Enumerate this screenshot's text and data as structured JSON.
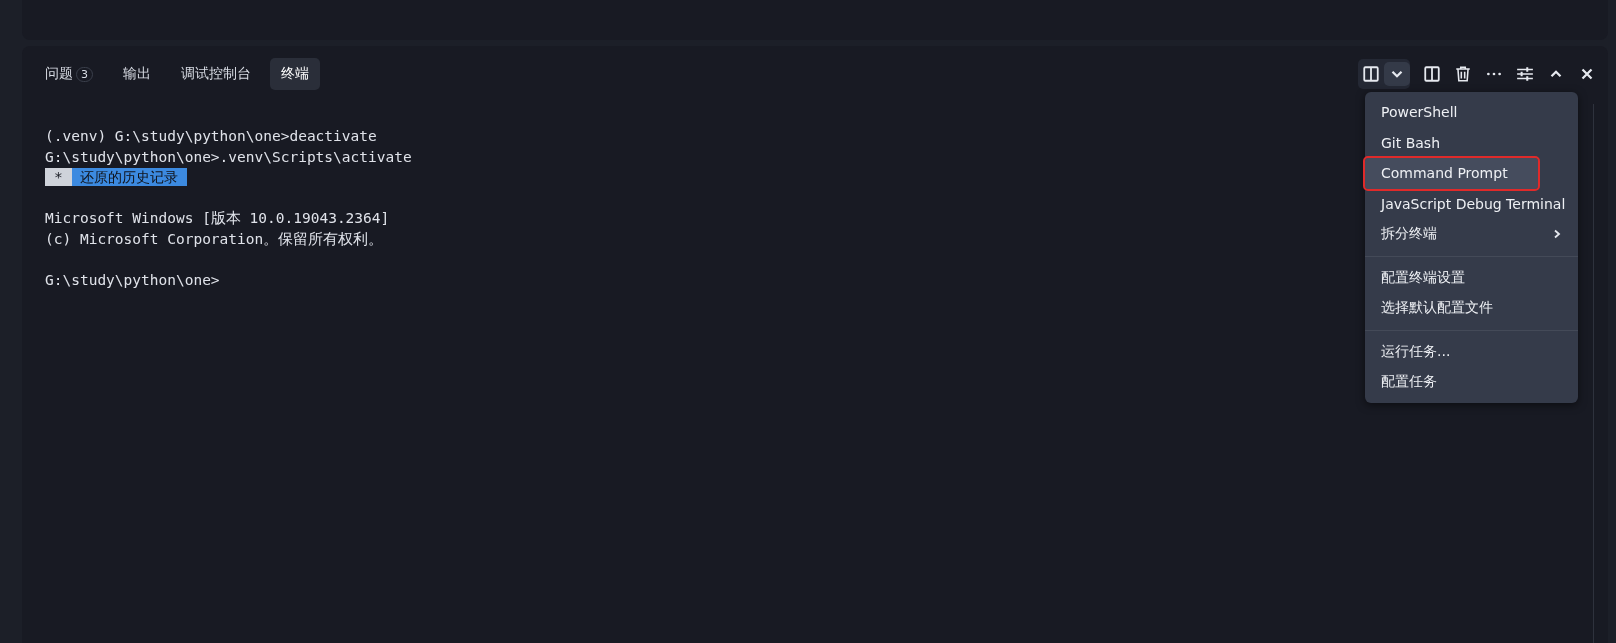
{
  "tabs": [
    {
      "label": "问题",
      "badge": "3",
      "selected": false
    },
    {
      "label": "输出",
      "selected": false
    },
    {
      "label": "调试控制台",
      "selected": false
    },
    {
      "label": "终端",
      "selected": true
    }
  ],
  "launcher": {
    "expanded": true
  },
  "terminal": {
    "lines": [
      {
        "kind": "text",
        "text": "(.venv) G:\\study\\python\\one>deactivate"
      },
      {
        "kind": "text",
        "text": "G:\\study\\python\\one>.venv\\Scripts\\activate"
      },
      {
        "kind": "marker",
        "mark": "*",
        "text": "还原的历史记录"
      },
      {
        "kind": "blank"
      },
      {
        "kind": "text",
        "text": "Microsoft Windows [版本 10.0.19043.2364]"
      },
      {
        "kind": "text",
        "text": "(c) Microsoft Corporation。保留所有权利。"
      },
      {
        "kind": "blank"
      },
      {
        "kind": "text",
        "text": "G:\\study\\python\\one>"
      }
    ]
  },
  "menu": {
    "sections": [
      [
        {
          "label": "PowerShell",
          "kind": "item",
          "selected": false,
          "outlined": false
        },
        {
          "label": "Git Bash",
          "kind": "item",
          "selected": false,
          "outlined": false
        },
        {
          "label": "Command Prompt",
          "kind": "item",
          "selected": true,
          "outlined": true
        },
        {
          "label": "JavaScript Debug Terminal",
          "kind": "item",
          "selected": false,
          "outlined": false
        },
        {
          "label": "拆分终端",
          "kind": "submenu",
          "selected": false,
          "outlined": false
        }
      ],
      [
        {
          "label": "配置终端设置",
          "kind": "item",
          "selected": false,
          "outlined": false
        },
        {
          "label": "选择默认配置文件",
          "kind": "item",
          "selected": false,
          "outlined": false
        }
      ],
      [
        {
          "label": "运行任务...",
          "kind": "item",
          "selected": false,
          "outlined": false
        },
        {
          "label": "配置任务",
          "kind": "item",
          "selected": false,
          "outlined": false
        }
      ]
    ]
  }
}
